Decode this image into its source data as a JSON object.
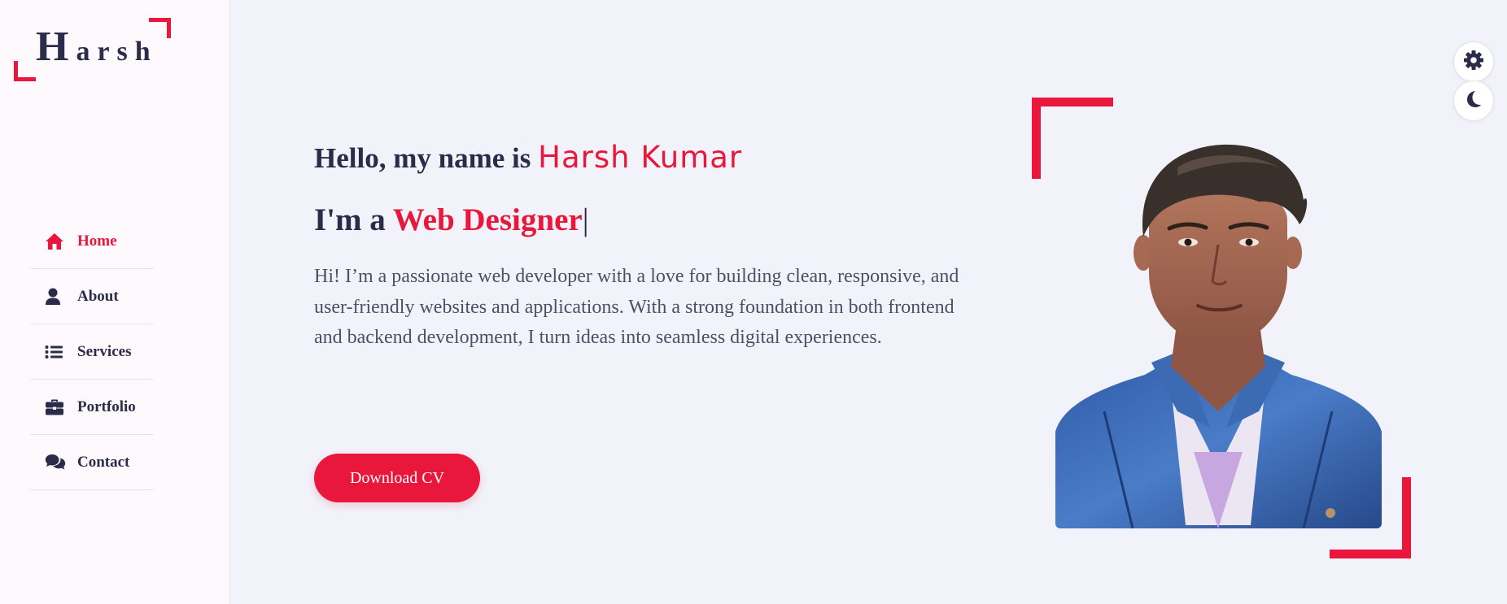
{
  "sidebar": {
    "logo": {
      "first_letter": "H",
      "rest": "arsh"
    },
    "items": [
      {
        "label": "Home",
        "icon": "home-icon",
        "active": true
      },
      {
        "label": "About",
        "icon": "user-icon",
        "active": false
      },
      {
        "label": "Services",
        "icon": "list-icon",
        "active": false
      },
      {
        "label": "Portfolio",
        "icon": "briefcase-icon",
        "active": false
      },
      {
        "label": "Contact",
        "icon": "comments-icon",
        "active": false
      }
    ]
  },
  "hero": {
    "greeting": "Hello, my name is",
    "name": "Harsh Kumar",
    "role_prefix": "I'm a",
    "role_title": "Web Designer",
    "cursor": "|",
    "bio": "Hi! I’m a passionate web developer with a love for building clean, responsive, and user-friendly websites and applications. With a strong foundation in both frontend and backend development, I turn ideas into seamless digital experiences.",
    "cv_button": "Download CV"
  },
  "controls": {
    "settings_icon": "gear-icon",
    "theme_icon": "moon-icon"
  },
  "colors": {
    "accent": "#e8173b",
    "text_dark": "#2b2c4a",
    "background": "#f1f2fa",
    "sidebar_bg": "#fdf9fd"
  }
}
